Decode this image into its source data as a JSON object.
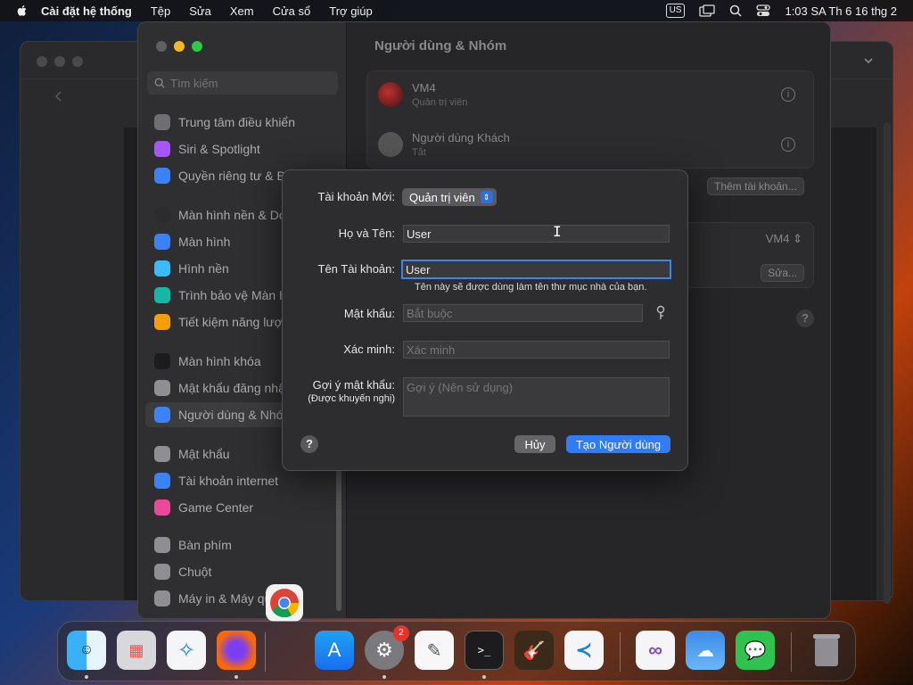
{
  "menubar": {
    "app": "Cài đặt hệ thống",
    "items": [
      "Tệp",
      "Sửa",
      "Xem",
      "Cửa sổ",
      "Trợ giúp"
    ],
    "input_source": "US",
    "clock": "1:03 SA Th 6 16 thg 2"
  },
  "sidebar": {
    "search_placeholder": "Tìm kiếm",
    "items": [
      {
        "label": "Trung tâm điều khiển",
        "color": "#6e6e73",
        "icon": "control-center-icon"
      },
      {
        "label": "Siri & Spotlight",
        "color": "#a855f7",
        "icon": "siri-icon"
      },
      {
        "label": "Quyền riêng tư & Bảo mật",
        "color": "#3b82f6",
        "icon": "hand-icon"
      },
      {
        "label": "Màn hình nền & Dock",
        "color": "#2c2c2e",
        "icon": "dock-icon"
      },
      {
        "label": "Màn hình",
        "color": "#3b82f6",
        "icon": "display-icon"
      },
      {
        "label": "Hình nền",
        "color": "#38bdf8",
        "icon": "wallpaper-icon"
      },
      {
        "label": "Trình bảo vệ Màn hình",
        "color": "#14b8a6",
        "icon": "screensaver-icon"
      },
      {
        "label": "Tiết kiệm năng lượng",
        "color": "#f59e0b",
        "icon": "bulb-icon"
      },
      {
        "label": "Màn hình khóa",
        "color": "#1c1c1e",
        "icon": "lock-screen-icon"
      },
      {
        "label": "Mật khẩu đăng nhập",
        "color": "#8e8e93",
        "icon": "login-password-icon"
      },
      {
        "label": "Người dùng & Nhóm",
        "color": "#3b82f6",
        "icon": "users-icon"
      },
      {
        "label": "Mật khẩu",
        "color": "#8e8e93",
        "icon": "key-icon"
      },
      {
        "label": "Tài khoản internet",
        "color": "#3b82f6",
        "icon": "at-icon"
      },
      {
        "label": "Game Center",
        "color": "#ec4899",
        "icon": "game-center-icon"
      },
      {
        "label": "Bàn phím",
        "color": "#8e8e93",
        "icon": "keyboard-icon"
      },
      {
        "label": "Chuột",
        "color": "#8e8e93",
        "icon": "mouse-icon"
      },
      {
        "label": "Máy in & Máy quét",
        "color": "#8e8e93",
        "icon": "printer-icon"
      }
    ]
  },
  "main": {
    "title": "Người dùng & Nhóm",
    "users": [
      {
        "name": "VM4",
        "role": "Quản trị viên"
      },
      {
        "name": "Người dùng Khách",
        "role": "Tắt"
      }
    ],
    "add_account": "Thêm tài khoản...",
    "autologin_value": "VM4",
    "edit": "Sửa...",
    "help": "?"
  },
  "dialog": {
    "account_label": "Tài khoản Mới:",
    "account_value": "Quản trị viên",
    "fullname_label": "Họ và Tên:",
    "fullname_value": "User",
    "account_name_label": "Tên Tài khoản:",
    "account_name_value": "User",
    "account_name_hint": "Tên này sẽ được dùng làm tên thư mục nhà của bạn.",
    "password_label": "Mật khẩu:",
    "password_placeholder": "Bắt buộc",
    "verify_label": "Xác minh:",
    "verify_placeholder": "Xác minh",
    "hint_label": "Gợi ý mật khẩu:",
    "hint_sublabel": "(Được khuyến nghị)",
    "hint_placeholder": "Gợi ý (Nên sử dụng)",
    "help": "?",
    "cancel": "Hủy",
    "create": "Tạo Người dùng"
  },
  "dock": {
    "badge_count": "2",
    "apps": [
      "Finder",
      "Launchpad",
      "Safari",
      "Firefox",
      "App Store",
      "System Settings",
      "TextEdit",
      "Terminal",
      "GarageBand",
      "Visual Studio Code",
      "Visual Studio",
      "Weather",
      "Messages",
      "Trash"
    ]
  }
}
